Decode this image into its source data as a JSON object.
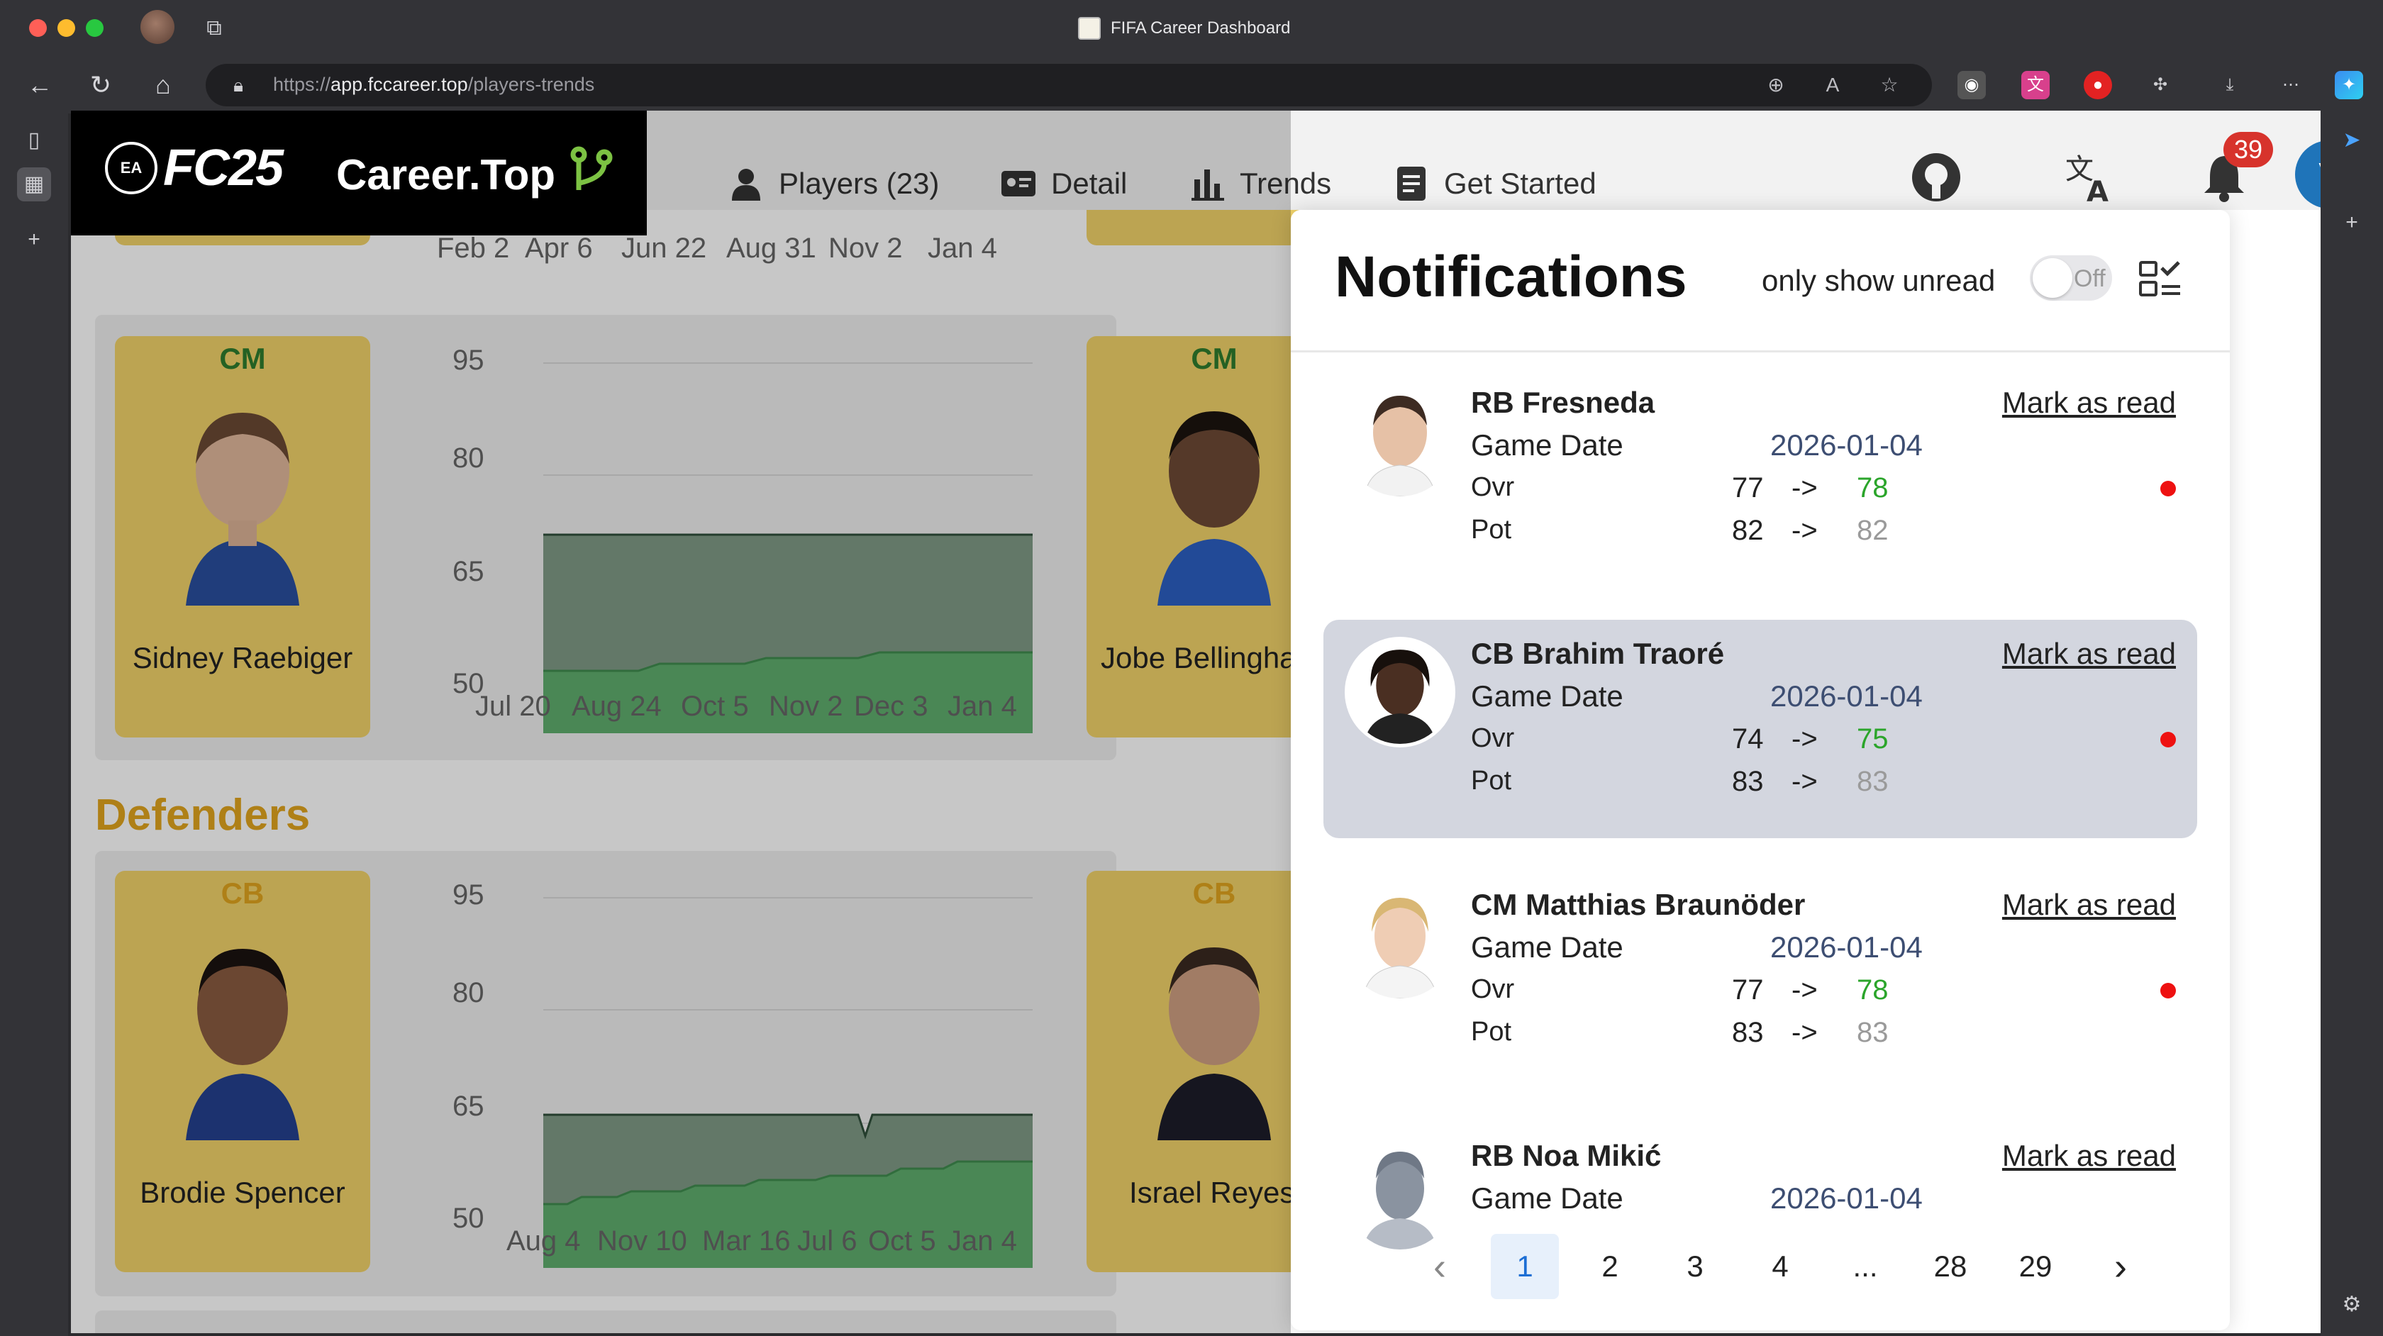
{
  "browser": {
    "title": "FIFA Career Dashboard",
    "url_domain_prefix": "https://",
    "url_domain": "app.fccareer.top",
    "url_path": "/players-trends"
  },
  "site": {
    "brand_fc": "FC25",
    "brand_ea": "EA",
    "brand_name": "Career.Top",
    "nav": [
      {
        "label": "Players (23)",
        "icon": "person-icon"
      },
      {
        "label": "Detail",
        "icon": "id-card-icon"
      },
      {
        "label": "Trends",
        "icon": "bar-chart-icon"
      },
      {
        "label": "Get Started",
        "icon": "document-icon"
      }
    ],
    "notification_count": "39",
    "avatar_initial": "V"
  },
  "background": {
    "section_title": "Defenders",
    "top_axis": [
      "Feb 2",
      "Apr 6",
      "Jun 22",
      "Aug 31",
      "Nov 2",
      "Jan 4"
    ],
    "cards": [
      {
        "position": "CM",
        "name": "Sidney Raebiger"
      },
      {
        "position": "CM",
        "name": "Jobe Bellingha"
      },
      {
        "position": "CB",
        "name": "Brodie Spencer"
      },
      {
        "position": "CB",
        "name": "Israel Reyes"
      }
    ],
    "charts": [
      {
        "yticks": [
          "95",
          "80",
          "65",
          "50"
        ],
        "xticks": [
          "Jul 20",
          "Aug 24",
          "Oct 5",
          "Nov 2",
          "Dec 3",
          "Jan 4"
        ]
      },
      {
        "yticks": [
          "95",
          "80",
          "65",
          "50"
        ],
        "xticks": [
          "Aug 4",
          "Nov 10",
          "Mar 16",
          "Jul 6",
          "Oct 5",
          "Jan 4"
        ]
      }
    ],
    "chart_colors": {
      "ovr": "#5fae6e",
      "pot": "#7f9a86"
    }
  },
  "notifications": {
    "title": "Notifications",
    "only_unread_label": "only show unread",
    "toggle_state": "Off",
    "mark_label": "Mark as read",
    "game_date_label": "Game Date",
    "ovr_label": "Ovr",
    "pot_label": "Pot",
    "arrow": "->",
    "items": [
      {
        "pos": "RB",
        "name": "Fresneda",
        "date": "2026-01-04",
        "ovr_old": "77",
        "ovr_new": "78",
        "pot_old": "82",
        "pot_new": "82",
        "unread": true
      },
      {
        "pos": "CB",
        "name": "Brahim Traoré",
        "date": "2026-01-04",
        "ovr_old": "74",
        "ovr_new": "75",
        "pot_old": "83",
        "pot_new": "83",
        "unread": true
      },
      {
        "pos": "CM",
        "name": "Matthias Braunöder",
        "date": "2026-01-04",
        "ovr_old": "77",
        "ovr_new": "78",
        "pot_old": "83",
        "pot_new": "83",
        "unread": true
      },
      {
        "pos": "RB",
        "name": "Noa Mikić",
        "date": "2026-01-04"
      }
    ],
    "pagination": {
      "pages": [
        "1",
        "2",
        "3",
        "4",
        "...",
        "28",
        "29"
      ],
      "current": "1"
    }
  }
}
